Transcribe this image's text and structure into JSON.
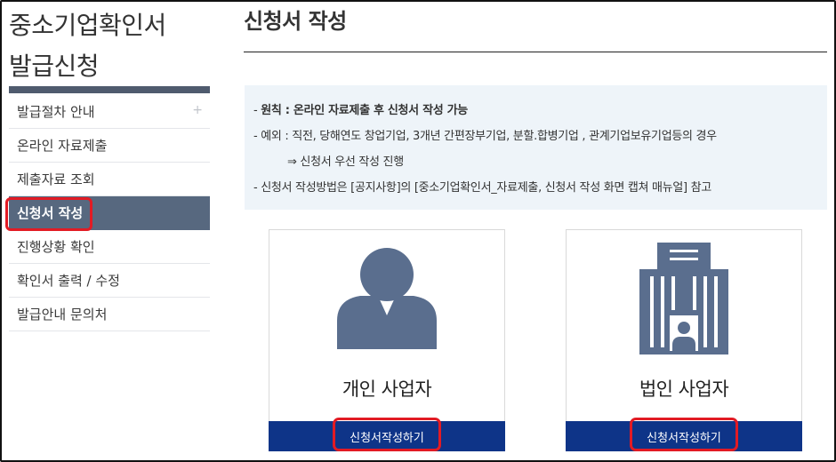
{
  "sidebar": {
    "title_line1": "중소기업확인서",
    "title_line2": "발급신청",
    "items": [
      {
        "label": "발급절차 안내",
        "plus": "+"
      },
      {
        "label": "온라인 자료제출"
      },
      {
        "label": "제출자료 조회"
      },
      {
        "label": "신청서 작성"
      },
      {
        "label": "진행상황 확인"
      },
      {
        "label": "확인서 출력 / 수정"
      },
      {
        "label": "발급안내 문의처"
      }
    ],
    "active_index": 3
  },
  "main": {
    "title": "신청서 작성",
    "notice": {
      "line1_prefix": "- ",
      "line1_bold": "원칙 : 온라인 자료제출 후 신청서 작성 가능",
      "line2": "- 예외 : 직전, 당해연도 창업기업, 3개년 간편장부기업, 분할.합병기업 , 관계기업보유기업등의 경우",
      "line3": "⇒ 신청서 우선 작성 진행",
      "line4": "- 신청서 작성방법은 [공지사항]의 [중소기업확인서_자료제출, 신청서 작성 화면 캡쳐 매뉴얼] 참고"
    },
    "cards": [
      {
        "label": "개인 사업자",
        "button": "신청서작성하기",
        "icon": "person-icon"
      },
      {
        "label": "법인 사업자",
        "button": "신청서작성하기",
        "icon": "building-icon"
      }
    ]
  },
  "colors": {
    "sidebar_active": "#57687f",
    "sidebar_bar": "#4f5b6e",
    "button_bg": "#0e3488",
    "highlight": "#e21b24",
    "notice_bg": "#eef4f9",
    "icon": "#5a6e8e"
  }
}
